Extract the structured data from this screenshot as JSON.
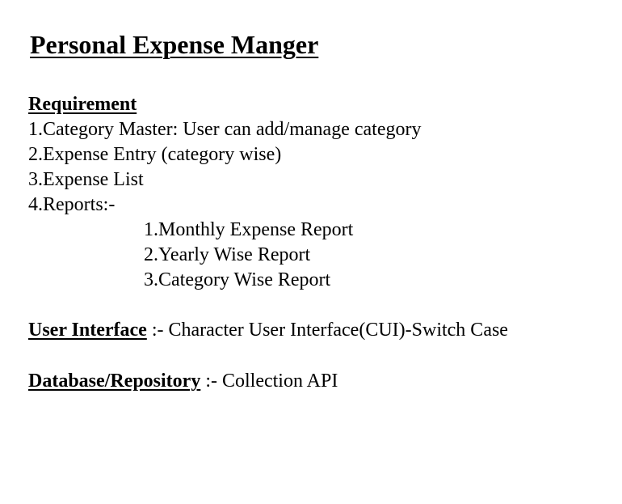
{
  "title": "Personal Expense Manger",
  "requirement": {
    "heading": "Requirement",
    "items": [
      "1.Category Master: User can add/manage category",
      "2.Expense Entry (category wise)",
      "3.Expense List",
      "4.Reports:-"
    ],
    "reports": [
      "1.Monthly Expense Report",
      "2.Yearly Wise Report",
      "3.Category Wise Report"
    ]
  },
  "user_interface": {
    "heading": "User Interface",
    "text": " :- Character User Interface(CUI)-Switch Case"
  },
  "database": {
    "heading": "Database/Repository",
    "text": " :- Collection API"
  }
}
